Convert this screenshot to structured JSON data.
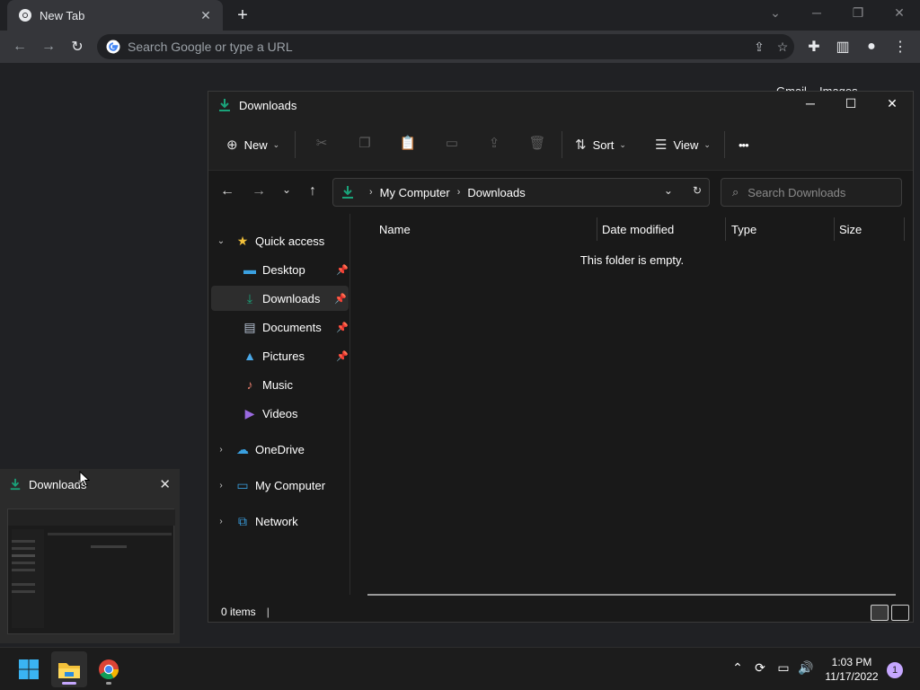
{
  "chrome": {
    "tab_title": "New Tab",
    "omnibox_placeholder": "Search Google or type a URL",
    "ntp_links": [
      "Gmail",
      "Images"
    ]
  },
  "explorer": {
    "title": "Downloads",
    "commands": {
      "new": "New",
      "sort": "Sort",
      "view": "View",
      "more": "•••"
    },
    "breadcrumb": [
      "My Computer",
      "Downloads"
    ],
    "search_placeholder": "Search Downloads",
    "nav": {
      "quick_access": "Quick access",
      "items": [
        "Desktop",
        "Downloads",
        "Documents",
        "Pictures",
        "Music",
        "Videos"
      ],
      "onedrive": "OneDrive",
      "my_computer": "My Computer",
      "network": "Network"
    },
    "columns": [
      "Name",
      "Date modified",
      "Type",
      "Size"
    ],
    "empty_message": "This folder is empty.",
    "status": "0 items",
    "colors": {
      "accent": "#1aa37a",
      "folder": "#f3c13a",
      "selected": "#2d2d2d"
    }
  },
  "preview": {
    "title": "Downloads"
  },
  "taskbar": {
    "time": "1:03 PM",
    "date": "11/17/2022",
    "notification_count": "1"
  }
}
